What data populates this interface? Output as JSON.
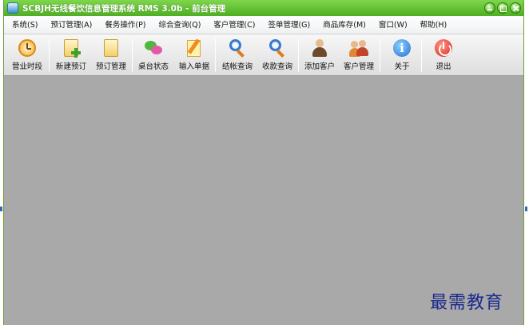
{
  "window": {
    "title": "SCBJH无线餐饮信息管理系统 RMS 3.0b - 前台管理"
  },
  "menu": [
    {
      "label": "系统(S)"
    },
    {
      "label": "预订管理(A)"
    },
    {
      "label": "餐务操作(P)"
    },
    {
      "label": "综合查询(Q)"
    },
    {
      "label": "客户管理(C)"
    },
    {
      "label": "签单管理(G)"
    },
    {
      "label": "商品库存(M)"
    },
    {
      "label": "窗口(W)"
    },
    {
      "label": "帮助(H)"
    }
  ],
  "toolbar": {
    "business_hours": "营业时段",
    "new_reservation": "新建预订",
    "reservation_management": "预订管理",
    "table_status": "桌台状态",
    "enter_order": "输入单据",
    "checkout_query": "结帐查询",
    "payment_query": "收款查询",
    "add_customer": "添加客户",
    "customer_management": "客户管理",
    "about": "关于",
    "exit": "退出"
  },
  "watermark": "最需教育",
  "colors": {
    "titlebar": "#5cbf2c",
    "workspace": "#a9a9a9",
    "watermark": "#1b2a8c"
  }
}
